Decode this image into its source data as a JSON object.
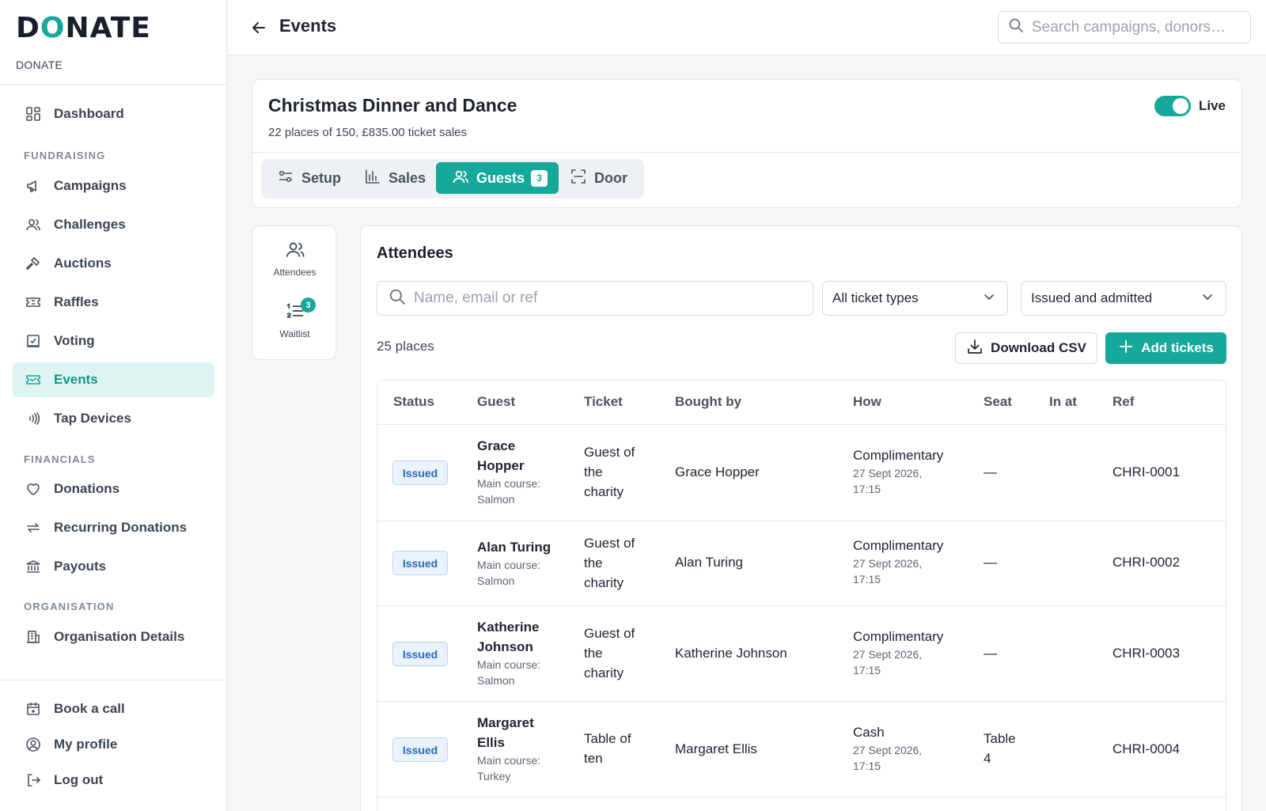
{
  "brand": {
    "logo_text": "DONATE",
    "org_name": "DONATE"
  },
  "sidebar": {
    "dashboard": "Dashboard",
    "sections": {
      "fundraising": "FUNDRAISING",
      "financials": "FINANCIALS",
      "organisation": "ORGANISATION"
    },
    "items": {
      "campaigns": "Campaigns",
      "challenges": "Challenges",
      "auctions": "Auctions",
      "raffles": "Raffles",
      "voting": "Voting",
      "events": "Events",
      "tap_devices": "Tap Devices",
      "donations": "Donations",
      "recurring_donations": "Recurring Donations",
      "payouts": "Payouts",
      "organisation_details": "Organisation Details"
    },
    "footer": {
      "book_call": "Book a call",
      "my_profile": "My profile",
      "log_out": "Log out"
    }
  },
  "header": {
    "title": "Events",
    "search_placeholder": "Search campaigns, donors…"
  },
  "event": {
    "title": "Christmas Dinner and Dance",
    "summary": "22 places of 150, £835.00 ticket sales",
    "live_label": "Live",
    "live": true,
    "tabs": {
      "setup": "Setup",
      "sales": "Sales",
      "guests": "Guests",
      "guests_count": "3",
      "door": "Door"
    }
  },
  "subnav": {
    "attendees": "Attendees",
    "waitlist": "Waitlist",
    "waitlist_count": "3"
  },
  "attendees": {
    "title": "Attendees",
    "search_placeholder": "Name, email or ref",
    "ticket_filter": "All ticket types",
    "status_filter": "Issued and admitted",
    "places": "25 places",
    "download_csv": "Download CSV",
    "add_tickets": "Add tickets",
    "columns": {
      "status": "Status",
      "guest": "Guest",
      "ticket": "Ticket",
      "bought_by": "Bought by",
      "how": "How",
      "seat": "Seat",
      "in_at": "In at",
      "ref": "Ref"
    },
    "rows": [
      {
        "status": "Issued",
        "guest_line1": "Grace",
        "guest_line2": "Hopper",
        "note1": "Main course:",
        "note2": "Salmon",
        "ticket1": "Guest of",
        "ticket2": "the",
        "ticket3": "charity",
        "bought_by": "Grace Hopper",
        "how": "Complimentary",
        "date1": "27 Sept 2026,",
        "date2": "17:15",
        "seat1": "—",
        "seat2": "",
        "in_at": "",
        "ref": "CHRI-0001"
      },
      {
        "status": "Issued",
        "guest_line1": "Alan Turing",
        "guest_line2": "",
        "note1": "Main course:",
        "note2": "Salmon",
        "ticket1": "Guest of",
        "ticket2": "the",
        "ticket3": "charity",
        "bought_by": "Alan Turing",
        "how": "Complimentary",
        "date1": "27 Sept 2026,",
        "date2": "17:15",
        "seat1": "—",
        "seat2": "",
        "in_at": "",
        "ref": "CHRI-0002"
      },
      {
        "status": "Issued",
        "guest_line1": "Katherine",
        "guest_line2": "Johnson",
        "note1": "Main course:",
        "note2": "Salmon",
        "ticket1": "Guest of",
        "ticket2": "the",
        "ticket3": "charity",
        "bought_by": "Katherine Johnson",
        "how": "Complimentary",
        "date1": "27 Sept 2026,",
        "date2": "17:15",
        "seat1": "—",
        "seat2": "",
        "in_at": "",
        "ref": "CHRI-0003"
      },
      {
        "status": "Issued",
        "guest_line1": "Margaret",
        "guest_line2": "Ellis",
        "note1": "Main course:",
        "note2": "Turkey",
        "ticket1": "Table of",
        "ticket2": "ten",
        "ticket3": "",
        "bought_by": "Margaret Ellis",
        "how": "Cash",
        "date1": "27 Sept 2026,",
        "date2": "17:15",
        "seat1": "Table",
        "seat2": "4",
        "in_at": "",
        "ref": "CHRI-0004"
      }
    ]
  },
  "colors": {
    "accent": "#16a89a",
    "active_bg": "#dff4f1",
    "badge_bg": "#eaf2fb",
    "badge_text": "#2c6bb6"
  },
  "icons": [
    "grid-icon",
    "megaphone-icon",
    "users-icon",
    "gavel-icon",
    "ticket-icon",
    "ballot-icon",
    "event-ticket-icon",
    "tap-icon",
    "heart-icon",
    "repeat-icon",
    "bank-icon",
    "building-icon",
    "calendar-icon",
    "user-circle-icon",
    "logout-icon",
    "arrow-left-icon",
    "search-icon",
    "sliders-icon",
    "bar-chart-icon",
    "scan-icon",
    "list-icon",
    "chevron-down-icon",
    "download-icon",
    "plus-icon"
  ]
}
